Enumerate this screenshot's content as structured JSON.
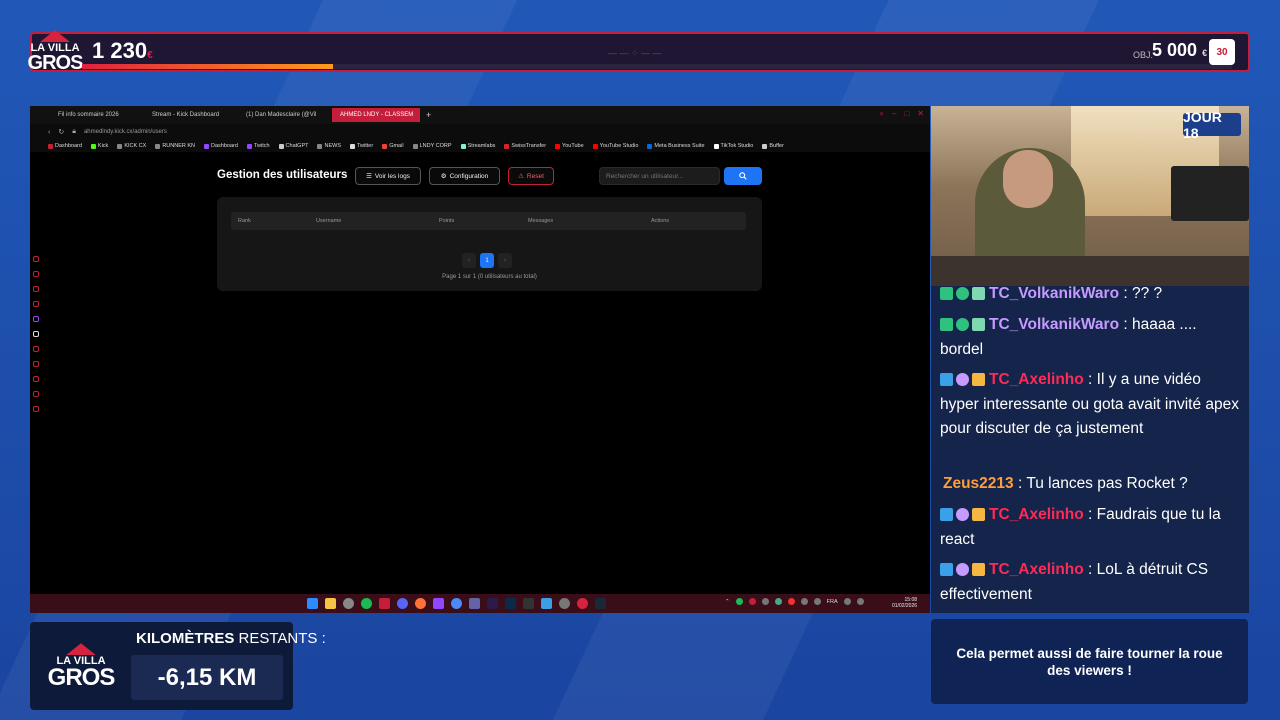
{
  "overlay": {
    "logo": {
      "line1": "LA VILLA",
      "line2": "GROS"
    },
    "score": "1 230",
    "score_unit": "€",
    "progress_fraction": 0.218,
    "objective_label": "OBJ.",
    "objective_value": "5 000",
    "objective_unit": "€",
    "badge_text": "30",
    "day_badge": "JOUR 18",
    "km_title_bold": "KILOMÈTRES",
    "km_title_rest": " RESTANTS :",
    "km_value": "-6,15 KM",
    "note": "Cela permet aussi de faire tourner la roue des viewers !"
  },
  "browser": {
    "tabs": [
      {
        "label": "Fil info sommaire 2026",
        "active": false
      },
      {
        "label": "Stream - Kick Dashboard",
        "active": false
      },
      {
        "label": "(1) Dan Madesclaire (@Vil",
        "active": false
      },
      {
        "label": "AHMED LNDY - CLASSEM",
        "active": true
      }
    ],
    "url": "ahmedlndy.kick.cx/admin/users",
    "bookmarks": [
      "Dashboard",
      "Kick",
      "KICK CX",
      "RUNNER KN",
      "Dashboard",
      "Twitch",
      "ChatGPT",
      "NEWS",
      "Twitter",
      "Gmail",
      "LNDY CORP",
      "Streamlabs",
      "SwissTransfer",
      "YouTube",
      "YouTube Studio",
      "Meta Business Suite",
      "TikTok Studio",
      "Buffer"
    ]
  },
  "admin": {
    "title": "Gestion des utilisateurs",
    "logs_button": "Voir les logs",
    "config_button": "Configuration",
    "reset_button": "Reset",
    "search_placeholder": "Rechercher un utilisateur...",
    "columns": [
      "Rank",
      "Username",
      "Points",
      "Messages",
      "Actions"
    ],
    "current_page": "1",
    "page_info": "Page 1 sur 1 (0 utilisateurs au total)"
  },
  "taskbar": {
    "lang": "FRA",
    "time": "15:08",
    "date": "01/02/2026"
  },
  "chat": [
    {
      "user": "TC_VolkanikWaro",
      "color": "#c59bff",
      "text": "?? ?"
    },
    {
      "user": "TC_VolkanikWaro",
      "color": "#c59bff",
      "text": "haaaa .... bordel"
    },
    {
      "user": "TC_Axelinho",
      "color": "#ff2a55",
      "text": "Il y a une vidéo hyper interessante ou gota avait invité apex pour discuter de ça justement"
    },
    {
      "user": "Zeus2213",
      "color": "#ff9e3b",
      "text": "Tu lances pas Rocket ?"
    },
    {
      "user": "TC_Axelinho",
      "color": "#ff2a55",
      "text": "Faudrais que tu la react"
    },
    {
      "user": "TC_Axelinho",
      "color": "#ff2a55",
      "text": "LoL à détruit CS effectivement"
    }
  ]
}
